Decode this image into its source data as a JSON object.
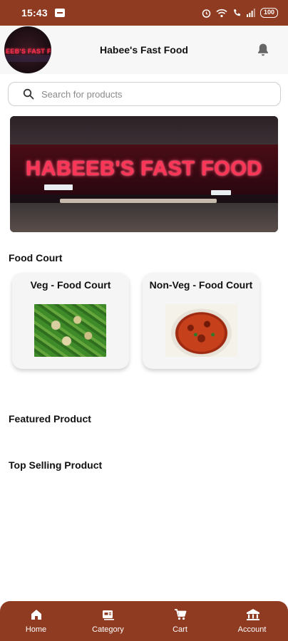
{
  "status_bar": {
    "time": "15:43",
    "battery": "100"
  },
  "header": {
    "title": "Habee's Fast Food",
    "logo_text": "EEB'S FAST FO"
  },
  "search": {
    "placeholder": "Search for products"
  },
  "banner": {
    "sign_text": "HABEEB'S FAST FOOD"
  },
  "sections": {
    "food_court": "Food Court",
    "featured": "Featured Product",
    "top_selling": "Top Selling Product"
  },
  "categories": [
    {
      "label": "Veg - Food Court"
    },
    {
      "label": "Non-Veg - Food Court"
    }
  ],
  "bottom_nav": [
    {
      "label": "Home",
      "icon": "home-icon"
    },
    {
      "label": "Category",
      "icon": "category-icon"
    },
    {
      "label": "Cart",
      "icon": "cart-icon"
    },
    {
      "label": "Account",
      "icon": "account-icon"
    }
  ],
  "colors": {
    "brand": "#8e3b22",
    "header_bg": "#f7f7f7",
    "card_bg": "#f6f5f5"
  }
}
